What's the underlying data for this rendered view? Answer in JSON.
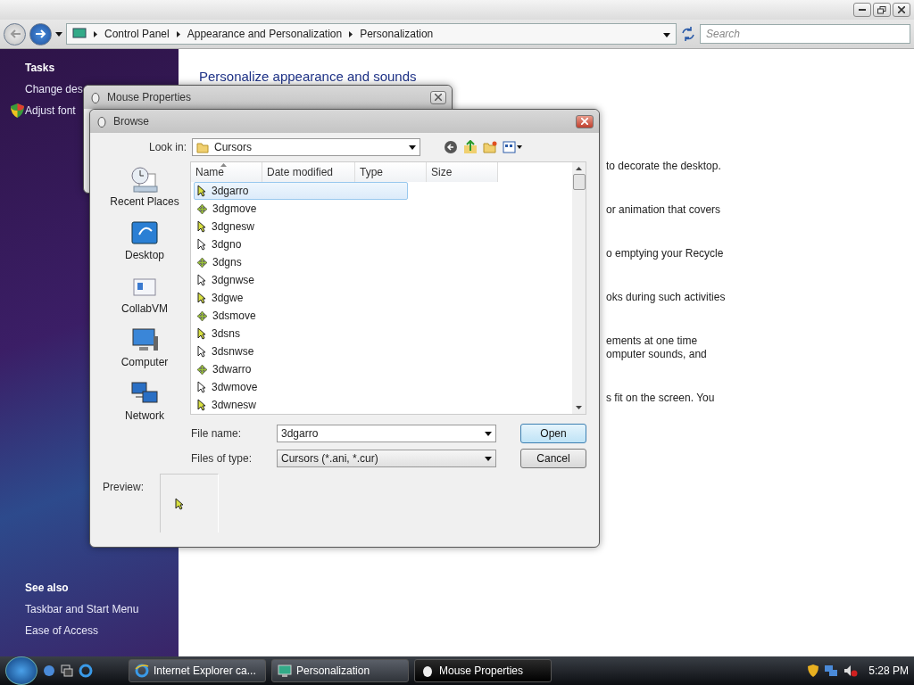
{
  "window": {
    "address": [
      "Control Panel",
      "Appearance and Personalization",
      "Personalization"
    ],
    "search": {
      "placeholder": "Search"
    }
  },
  "sidebar": {
    "tasks_heading": "Tasks",
    "tasks": [
      {
        "label": "Change des",
        "kind": "link"
      },
      {
        "label": "Adjust font",
        "kind": "shield"
      }
    ],
    "see_also_heading": "See also",
    "see_also": [
      "Taskbar and Start Menu",
      "Ease of Access"
    ]
  },
  "content": {
    "heading": "Personalize appearance and sounds",
    "fragments": [
      [
        "to decorate the desktop."
      ],
      [
        "or animation that covers"
      ],
      [
        "o emptying your Recycle"
      ],
      [
        "oks during such activities"
      ],
      [
        "ements at one time",
        "omputer sounds, and"
      ],
      [
        "s fit on the screen. You"
      ]
    ]
  },
  "mouse_properties": {
    "title": "Mouse Properties"
  },
  "browse": {
    "title": "Browse",
    "look_in_label": "Look in:",
    "look_in": "Cursors",
    "places": [
      {
        "label": "Recent Places",
        "kind": "recent"
      },
      {
        "label": "Desktop",
        "kind": "desktop"
      },
      {
        "label": "CollabVM",
        "kind": "folder"
      },
      {
        "label": "Computer",
        "kind": "computer"
      },
      {
        "label": "Network",
        "kind": "network"
      }
    ],
    "columns": [
      {
        "label": "Name",
        "sorted": true
      },
      {
        "label": "Date modified",
        "sorted": false
      },
      {
        "label": "Type",
        "sorted": false
      },
      {
        "label": "Size",
        "sorted": false
      }
    ],
    "files": [
      {
        "name": "3dgarro",
        "selected": true
      },
      {
        "name": "3dgmove",
        "selected": false
      },
      {
        "name": "3dgnesw",
        "selected": false
      },
      {
        "name": "3dgno",
        "selected": false
      },
      {
        "name": "3dgns",
        "selected": false
      },
      {
        "name": "3dgnwse",
        "selected": false
      },
      {
        "name": "3dgwe",
        "selected": false
      },
      {
        "name": "3dsmove",
        "selected": false
      },
      {
        "name": "3dsns",
        "selected": false
      },
      {
        "name": "3dsnwse",
        "selected": false
      },
      {
        "name": "3dwarro",
        "selected": false
      },
      {
        "name": "3dwmove",
        "selected": false
      },
      {
        "name": "3dwnesw",
        "selected": false
      }
    ],
    "file_name_label": "File name:",
    "file_name": "3dgarro",
    "file_type_label": "Files of type:",
    "file_type": "Cursors (*.ani, *.cur)",
    "buttons": [
      {
        "label": "Open",
        "default": true
      },
      {
        "label": "Cancel",
        "default": false
      }
    ],
    "preview_label": "Preview:"
  },
  "taskbar": {
    "tasks": [
      {
        "label": "Internet Explorer ca...",
        "kind": "ie",
        "selected": false
      },
      {
        "label": "Personalization",
        "kind": "monitor",
        "selected": false
      },
      {
        "label": "Mouse Properties",
        "kind": "mouse",
        "selected": true
      }
    ],
    "clock": "5:28 PM"
  }
}
